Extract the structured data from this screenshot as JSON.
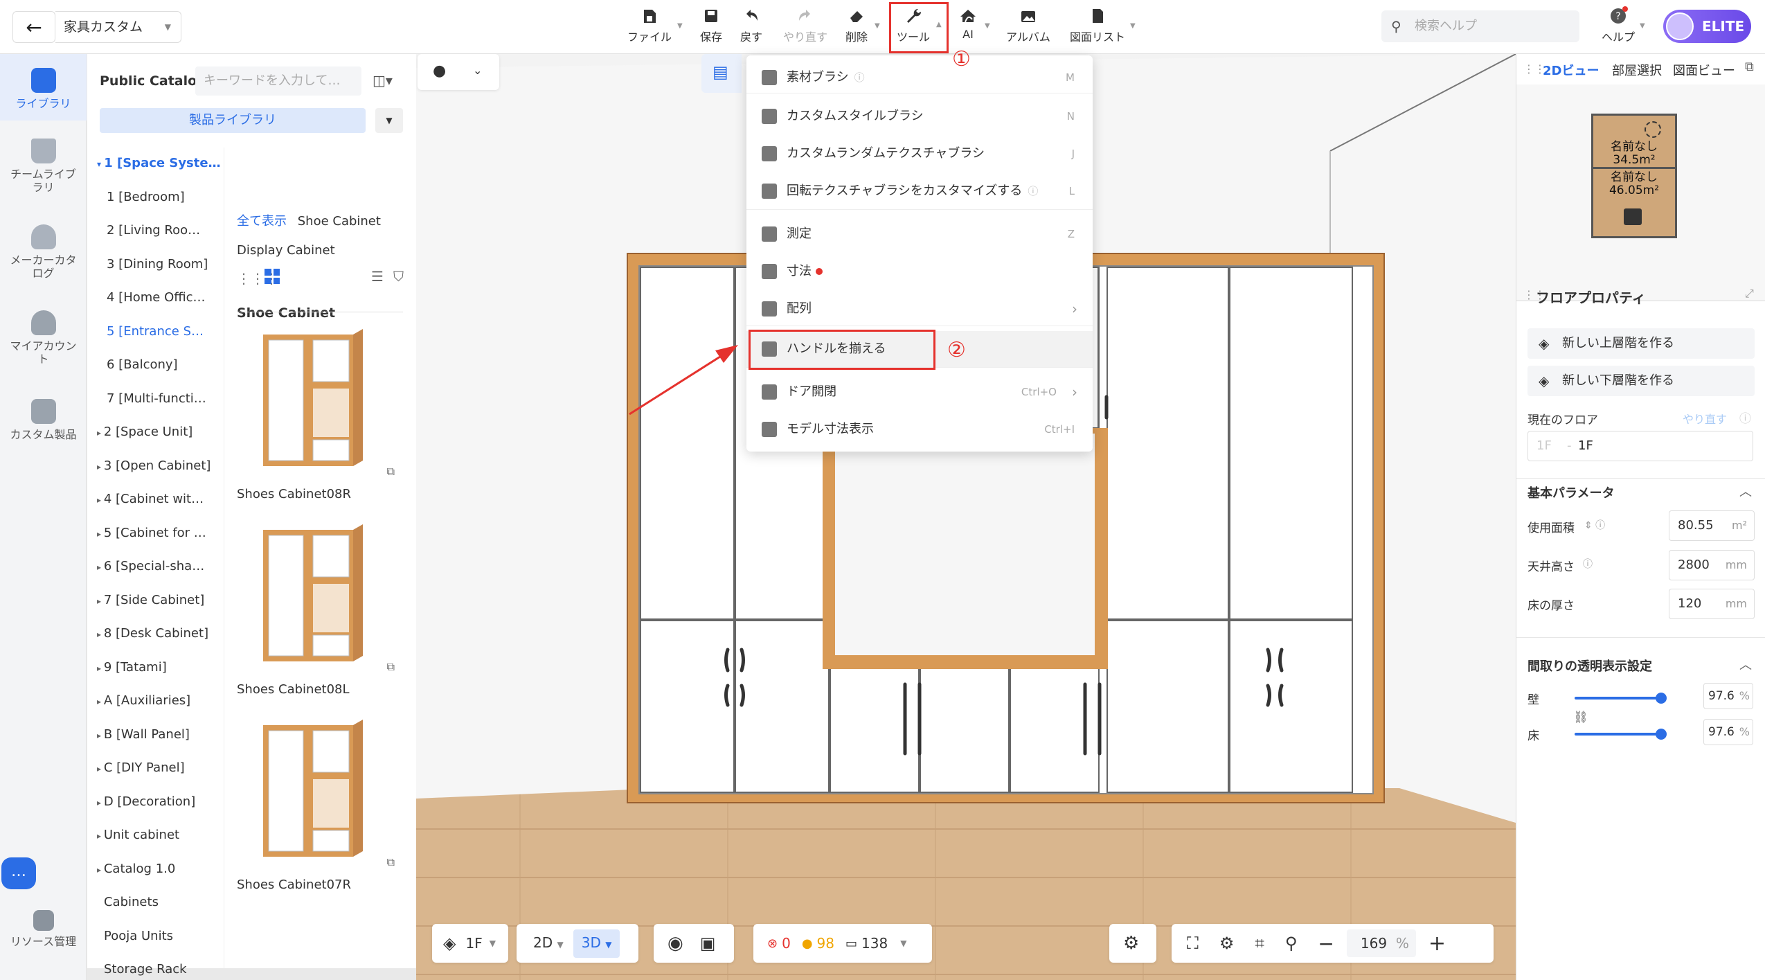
{
  "project": {
    "name": "家具カスタム"
  },
  "toolbar": {
    "file": "ファイル",
    "save": "保存",
    "undo": "戻す",
    "redo": "やり直す",
    "delete": "削除",
    "tools": "ツール",
    "ai": "AI",
    "album": "アルバム",
    "drawings": "図面リスト",
    "search_placeholder": "検索ヘルプ",
    "help": "ヘルプ",
    "elite": "ELITE"
  },
  "leftnav": {
    "items": [
      {
        "label": "ライブラリ",
        "icon": "library-icon"
      },
      {
        "label": "チームライブラリ",
        "icon": "crown-icon"
      },
      {
        "label": "メーカーカタログ",
        "icon": "maker-icon"
      },
      {
        "label": "マイアカウント",
        "icon": "user-icon"
      },
      {
        "label": "カスタム製品",
        "icon": "custom-icon"
      }
    ],
    "resource": "リソース管理"
  },
  "catalog": {
    "title": "Public Catalog",
    "search_placeholder": "キーワードを入力して…",
    "library_tab": "製品ライブラリ",
    "tree": [
      "1 [Space Syste…",
      "1 [Bedroom]",
      "2 [Living Roo…",
      "3 [Dining Room]",
      "4 [Home Offic…",
      "5 [Entrance S…",
      "6 [Balcony]",
      "7 [Multi-functi…",
      "2 [Space Unit]",
      "3 [Open Cabinet]",
      "4 [Cabinet wit…",
      "5 [Cabinet for …",
      "6 [Special-sha…",
      "7 [Side Cabinet]",
      "8 [Desk Cabinet]",
      "9 [Tatami]",
      "A [Auxiliaries]",
      "B [Wall Panel]",
      "C [DIY Panel]",
      "D [Decoration]",
      "Unit cabinet",
      "Catalog 1.0",
      "Cabinets",
      "Pooja Units",
      "Storage Rack"
    ],
    "breadcrumb_all": "全て表示",
    "breadcrumb_cur": "Shoe Cabinet",
    "sub": "Display Cabinet",
    "section": "Shoe Cabinet",
    "products": [
      "Shoes Cabinet08R",
      "Shoes Cabinet08L",
      "Shoes Cabinet07R"
    ]
  },
  "menu": {
    "items": [
      {
        "label": "素材ブラシ",
        "key": "M"
      },
      {
        "label": "カスタムスタイルブラシ",
        "key": "N"
      },
      {
        "label": "カスタムランダムテクスチャブラシ",
        "key": "J"
      },
      {
        "label": "回転テクスチャブラシをカスタマイズする",
        "key": "L"
      },
      {
        "label": "測定",
        "key": "Z"
      },
      {
        "label": "寸法",
        "key": ""
      },
      {
        "label": "配列",
        "key": ""
      },
      {
        "label": "ハンドルを揃える",
        "key": ""
      },
      {
        "label": "ドア開閉",
        "key": "Ctrl+O"
      },
      {
        "label": "モデル寸法表示",
        "key": "Ctrl+I"
      }
    ]
  },
  "annotations": {
    "one": "①",
    "two": "②"
  },
  "viewport": {
    "floor": "1F",
    "view2d": "2D",
    "view3d": "3D",
    "errors": "0",
    "warnings": "98",
    "items": "138",
    "zoom": "169",
    "zoom_unit": "%"
  },
  "right": {
    "tabs": [
      "2Dビュー",
      "部屋選択",
      "図面ビュー"
    ],
    "rooms": [
      {
        "name": "名前なし",
        "area": "34.5m²"
      },
      {
        "name": "名前なし",
        "area": "46.05m²"
      }
    ],
    "floor_props": "フロアプロパティ",
    "new_upper": "新しい上層階を作る",
    "new_lower": "新しい下層階を作る",
    "current_floor": "現在のフロア",
    "redo": "やり直す",
    "floor_placeholder": "1F",
    "floor_value": "1F",
    "basic": "基本パラメータ",
    "area_label": "使用面積",
    "area_value": "80.55",
    "area_unit": "m²",
    "ceiling_label": "天井高さ",
    "ceiling_value": "2800",
    "ceiling_unit": "mm",
    "thickness_label": "床の厚さ",
    "thickness_value": "120",
    "thickness_unit": "mm",
    "transparency": "間取りの透明表示設定",
    "wall_label": "壁",
    "wall_value": "97.6",
    "wall_pct": 0.976,
    "floor_label": "床",
    "floor_value2": "97.6",
    "floor_pct": 0.976,
    "pct": "%"
  },
  "colors": {
    "accent": "#2b6de5",
    "red": "#e5322d",
    "wood": "#d99a55",
    "elite": "#7b5cf0"
  }
}
